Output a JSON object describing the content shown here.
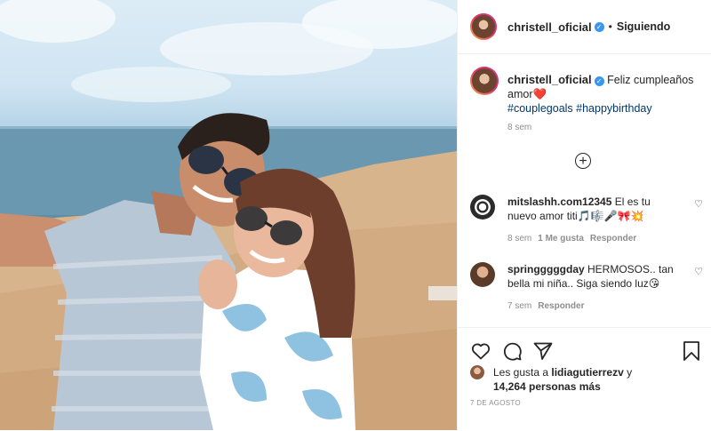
{
  "header": {
    "username": "christell_oficial",
    "verified_badge": "verified-badge-icon",
    "separator": "•",
    "follow_status": "Siguiendo"
  },
  "caption": {
    "username": "christell_oficial",
    "text": "Feliz cumpleaños amor",
    "emoji": "❤️",
    "hashtags": [
      "#couplegoals",
      "#happybirthday"
    ],
    "time": "8 sem"
  },
  "load_more_icon": "plus-circle-icon",
  "comments": [
    {
      "username": "mitslashh.com12345",
      "text": "El es tu nuevo amor titi",
      "emojis": "🎵🎼🎤🎀💥",
      "time": "8 sem",
      "likes": "1 Me gusta",
      "reply": "Responder"
    },
    {
      "username": "springggggday",
      "text": "HERMOSOS.. tan bella mi niña.. Siga siendo luz",
      "emojis": "😘",
      "time": "7 sem",
      "reply": "Responder"
    }
  ],
  "actions": {
    "like_icon": "heart-icon",
    "comment_icon": "comment-icon",
    "share_icon": "share-icon",
    "save_icon": "bookmark-icon"
  },
  "likes": {
    "prefix": "Les gusta a",
    "user": "lidiagutierrezv",
    "joiner": "y",
    "count": "14,264 personas más"
  },
  "date": "7 DE AGOSTO"
}
